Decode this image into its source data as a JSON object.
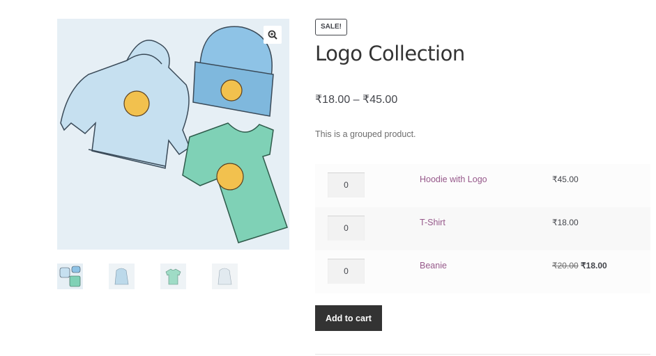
{
  "product": {
    "sale_badge": "SALE!",
    "title": "Logo Collection",
    "price_range": "₹18.00 – ₹45.00",
    "description": "This is a grouped product."
  },
  "gallery": {
    "zoom_icon": "magnifier-plus-icon",
    "thumbnails": [
      "logo-collection",
      "hoodie",
      "t-shirt",
      "hoodie-with-logo"
    ]
  },
  "grouped_items": [
    {
      "qty": "0",
      "name": "Hoodie with Logo",
      "price": "₹45.00"
    },
    {
      "qty": "0",
      "name": "T-Shirt",
      "price": "₹18.00"
    },
    {
      "qty": "0",
      "name": "Beanie",
      "regular_price": "₹20.00",
      "sale_price": "₹18.00"
    }
  ],
  "actions": {
    "add_to_cart": "Add to cart"
  },
  "colors": {
    "link": "#96588a",
    "button": "#333333",
    "text": "#43454b"
  }
}
